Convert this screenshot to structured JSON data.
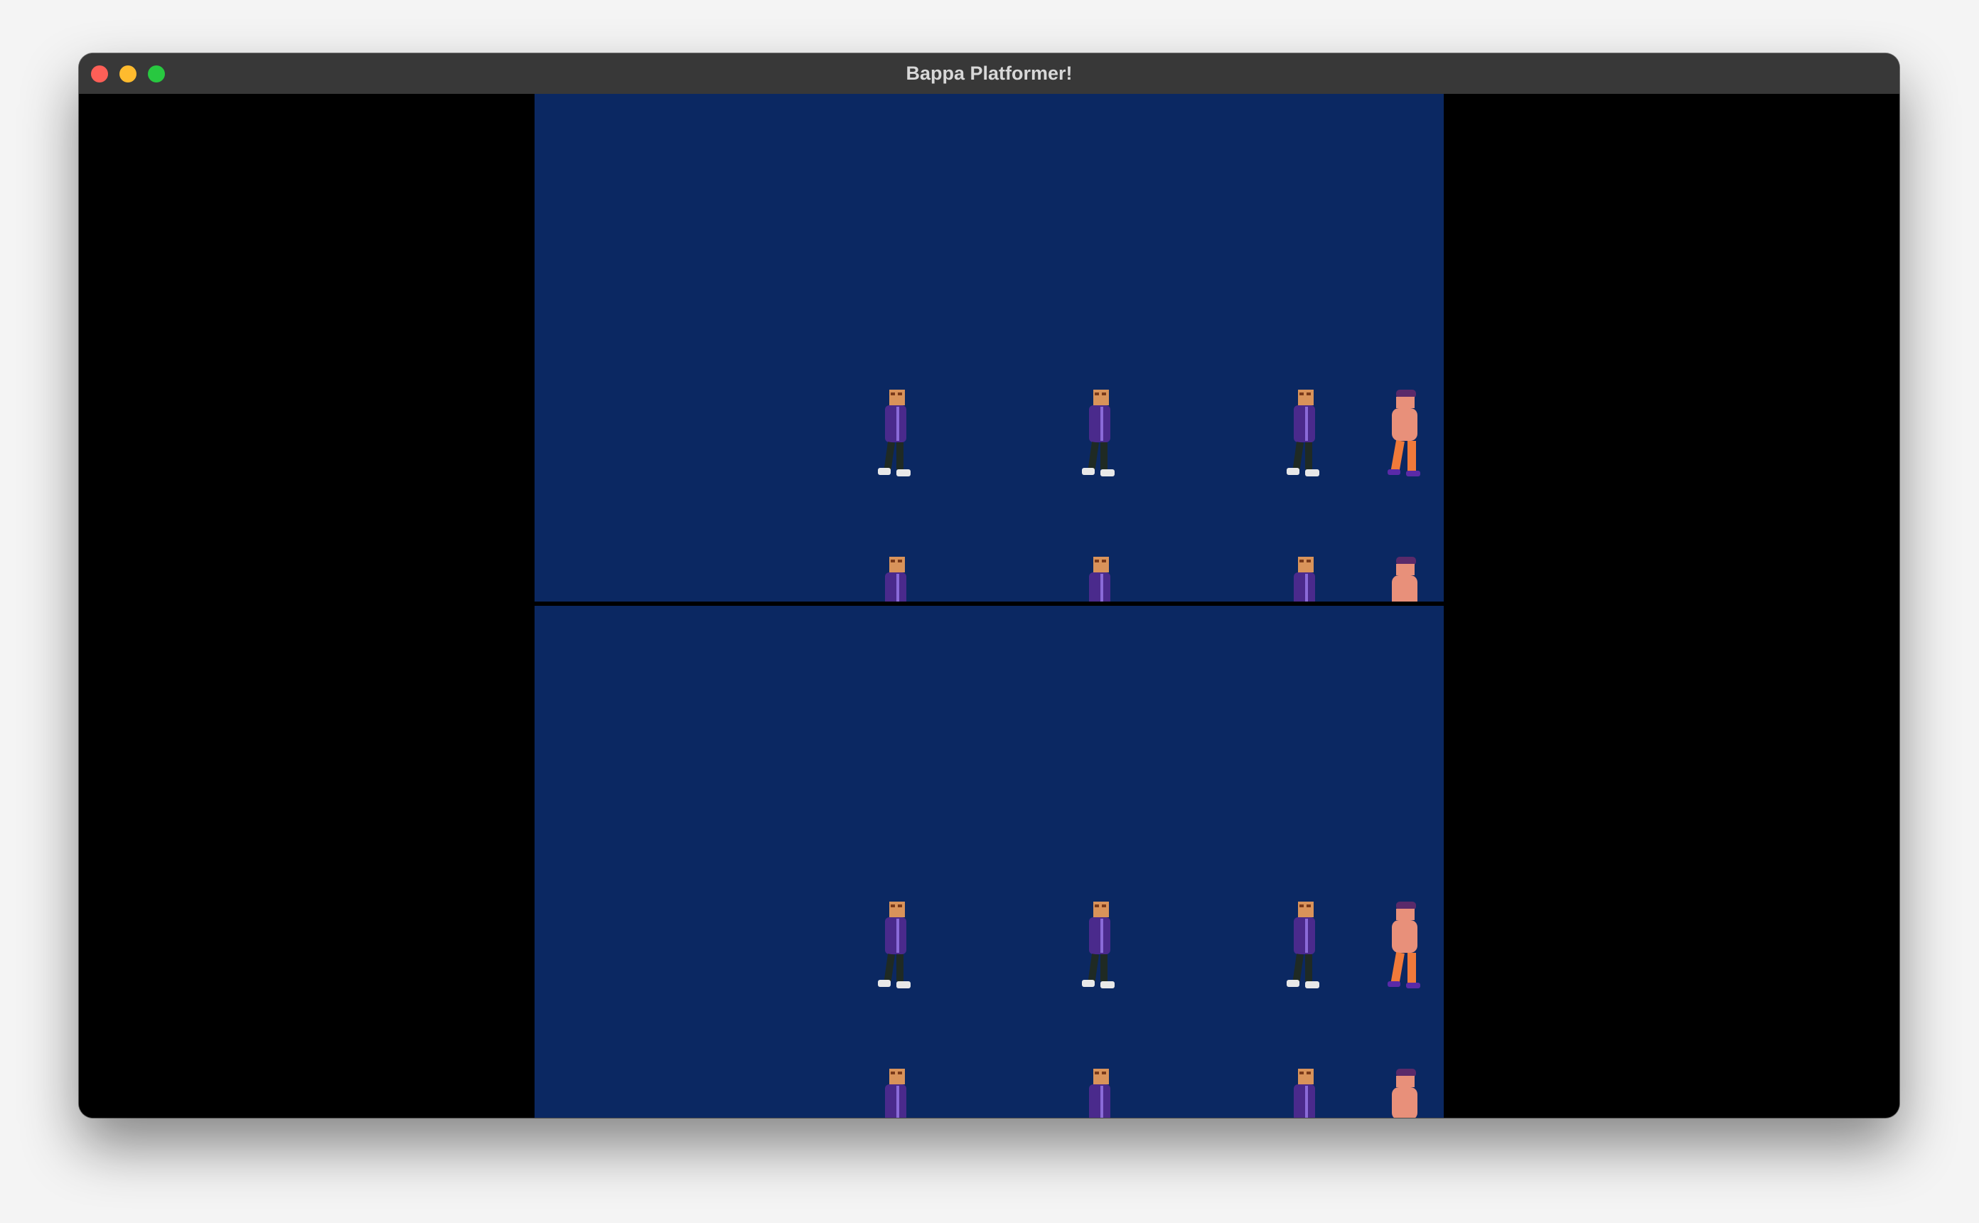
{
  "window": {
    "title": "Bappa Platformer!"
  },
  "game": {
    "background_color": "#0b2862",
    "letterbox_color": "#000000",
    "viewports": [
      {
        "name": "top",
        "characters": [
          "purple-jacket",
          "purple-jacket",
          "purple-jacket",
          "orange-figure",
          "purple-jacket",
          "purple-jacket",
          "purple-jacket",
          "orange-figure"
        ]
      },
      {
        "name": "bottom",
        "characters": [
          "purple-jacket",
          "purple-jacket",
          "purple-jacket",
          "orange-figure",
          "purple-jacket",
          "purple-jacket",
          "purple-jacket",
          "orange-figure"
        ]
      }
    ],
    "colors": {
      "purple_jacket": "#4a2a8c",
      "skin": "#d9935a",
      "pants": "#1f2a24",
      "shoes": "#e8e8e8",
      "orange_body": "#f07a3a",
      "orange_skin": "#e8907a"
    }
  }
}
